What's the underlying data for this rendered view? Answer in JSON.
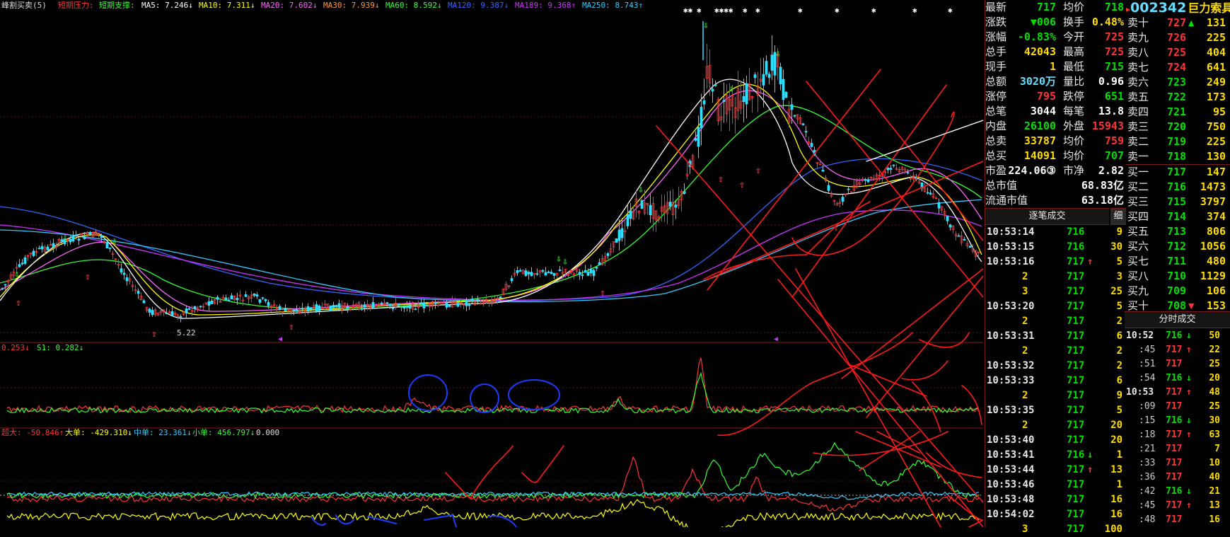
{
  "ma_bar": {
    "title": "峰割买卖(5)",
    "resist_label": "短期压力:",
    "support_label": "短期支撑:",
    "items": [
      {
        "label": "MA5: 7.246↓",
        "color": "#ffffff"
      },
      {
        "label": "MA10: 7.311↓",
        "color": "#ffff00"
      },
      {
        "label": "MA20: 7.602↓",
        "color": "#ff66ff"
      },
      {
        "label": "MA30: 7.939↓",
        "color": "#ff9933"
      },
      {
        "label": "MA60: 8.592↓",
        "color": "#33ff33"
      },
      {
        "label": "MA120: 9.387↓",
        "color": "#3366ff"
      },
      {
        "label": "MA189: 9.368↑",
        "color": "#cc33ff"
      },
      {
        "label": "MA250: 8.743↑",
        "color": "#33ccff"
      }
    ]
  },
  "price_annotation": "5.22",
  "indicator_bar": {
    "s0": "0.253↓",
    "s1": "S1: 0.282↓"
  },
  "flow_bar": {
    "items": [
      {
        "label": "超大: -50.846↑",
        "color": "#ff3333"
      },
      {
        "label": "大单: -429.310↓",
        "color": "#ffff00"
      },
      {
        "label": "中单: 23.361↓",
        "color": "#33ccff"
      },
      {
        "label": "小单: 456.797↓",
        "color": "#33ff33"
      },
      {
        "label": "0.000",
        "color": "#dddddd"
      }
    ]
  },
  "stock": {
    "code": "002342",
    "name": "巨力索具"
  },
  "quote": [
    {
      "l1": "最新",
      "v1": "717",
      "c1": "green",
      "l2": "均价",
      "v2": "718",
      "c2": "green"
    },
    {
      "l1": "涨跌",
      "v1": "▼006",
      "c1": "green",
      "l2": "换手",
      "v2": "0.48%",
      "c2": "yellow"
    },
    {
      "l1": "涨幅",
      "v1": "-0.83%",
      "c1": "green",
      "l2": "今开",
      "v2": "725",
      "c2": "red"
    },
    {
      "l1": "总手",
      "v1": "42043",
      "c1": "yellow",
      "l2": "最高",
      "v2": "725",
      "c2": "red"
    },
    {
      "l1": "现手",
      "v1": "1",
      "c1": "yellow",
      "l2": "最低",
      "v2": "715",
      "c2": "green"
    },
    {
      "l1": "总额",
      "v1": "3020万",
      "c1": "cyan",
      "l2": "量比",
      "v2": "0.96",
      "c2": "white"
    },
    {
      "l1": "涨停",
      "v1": "795",
      "c1": "red",
      "l2": "跌停",
      "v2": "651",
      "c2": "green"
    },
    {
      "l1": "总笔",
      "v1": "3044",
      "c1": "white",
      "l2": "每笔",
      "v2": "13.8",
      "c2": "white"
    },
    {
      "l1": "内盘",
      "v1": "26100",
      "c1": "green",
      "l2": "外盘",
      "v2": "15943",
      "c2": "red"
    },
    {
      "l1": "总卖",
      "v1": "33787",
      "c1": "yellow",
      "l2": "均价",
      "v2": "759",
      "c2": "red"
    },
    {
      "l1": "总买",
      "v1": "14091",
      "c1": "yellow",
      "l2": "均价",
      "v2": "707",
      "c2": "green"
    },
    {
      "l1": "市盈",
      "v1": "224.06③",
      "c1": "white",
      "l2": "市净",
      "v2": "2.82",
      "c2": "white"
    }
  ],
  "market_value": [
    {
      "label": "总市值",
      "value": "68.83亿"
    },
    {
      "label": "流通市值",
      "value": "63.18亿"
    }
  ],
  "trades_header": "逐笔成交",
  "trades_side_btn": "细",
  "trades": [
    {
      "t": "10:53:14",
      "p": "716",
      "q": "9",
      "a": ""
    },
    {
      "t": "10:53:15",
      "p": "716",
      "q": "30",
      "a": ""
    },
    {
      "t": "10:53:16",
      "p": "717",
      "q": "5",
      "a": "↑"
    },
    {
      "t": "2",
      "p": "717",
      "q": "3",
      "a": ""
    },
    {
      "t": "3",
      "p": "717",
      "q": "25",
      "a": ""
    },
    {
      "t": "10:53:20",
      "p": "717",
      "q": "5",
      "a": ""
    },
    {
      "t": "2",
      "p": "717",
      "q": "2",
      "a": ""
    },
    {
      "t": "10:53:31",
      "p": "717",
      "q": "6",
      "a": ""
    },
    {
      "t": "2",
      "p": "717",
      "q": "2",
      "a": ""
    },
    {
      "t": "10:53:32",
      "p": "717",
      "q": "2",
      "a": ""
    },
    {
      "t": "10:53:33",
      "p": "717",
      "q": "6",
      "a": ""
    },
    {
      "t": "2",
      "p": "717",
      "q": "9",
      "a": ""
    },
    {
      "t": "10:53:35",
      "p": "717",
      "q": "5",
      "a": ""
    },
    {
      "t": "2",
      "p": "717",
      "q": "20",
      "a": ""
    },
    {
      "t": "10:53:40",
      "p": "717",
      "q": "20",
      "a": ""
    },
    {
      "t": "10:53:41",
      "p": "716",
      "q": "1",
      "a": "↓"
    },
    {
      "t": "10:53:44",
      "p": "717",
      "q": "13",
      "a": "↑"
    },
    {
      "t": "10:53:46",
      "p": "717",
      "q": "1",
      "a": ""
    },
    {
      "t": "10:53:48",
      "p": "717",
      "q": "16",
      "a": ""
    },
    {
      "t": "10:54:02",
      "p": "717",
      "q": "16",
      "a": ""
    },
    {
      "t": "3",
      "p": "717",
      "q": "100",
      "a": ""
    }
  ],
  "order_book": {
    "asks": [
      {
        "label": "卖十",
        "p": "727",
        "q": "131",
        "c": "red",
        "a": "▲"
      },
      {
        "label": "卖九",
        "p": "726",
        "q": "225",
        "c": "red",
        "a": ""
      },
      {
        "label": "卖八",
        "p": "725",
        "q": "404",
        "c": "red",
        "a": ""
      },
      {
        "label": "卖七",
        "p": "724",
        "q": "641",
        "c": "red",
        "a": ""
      },
      {
        "label": "卖六",
        "p": "723",
        "q": "249",
        "c": "green",
        "a": ""
      },
      {
        "label": "卖五",
        "p": "722",
        "q": "173",
        "c": "green",
        "a": ""
      },
      {
        "label": "卖四",
        "p": "721",
        "q": "95",
        "c": "green",
        "a": ""
      },
      {
        "label": "卖三",
        "p": "720",
        "q": "750",
        "c": "green",
        "a": ""
      },
      {
        "label": "卖二",
        "p": "719",
        "q": "225",
        "c": "green",
        "a": ""
      },
      {
        "label": "卖一",
        "p": "718",
        "q": "130",
        "c": "green",
        "a": ""
      }
    ],
    "bids": [
      {
        "label": "买一",
        "p": "717",
        "q": "147",
        "c": "green",
        "a": ""
      },
      {
        "label": "买二",
        "p": "716",
        "q": "1473",
        "c": "green",
        "a": ""
      },
      {
        "label": "买三",
        "p": "715",
        "q": "3797",
        "c": "green",
        "a": ""
      },
      {
        "label": "买四",
        "p": "714",
        "q": "374",
        "c": "green",
        "a": ""
      },
      {
        "label": "买五",
        "p": "713",
        "q": "806",
        "c": "green",
        "a": ""
      },
      {
        "label": "买六",
        "p": "712",
        "q": "1056",
        "c": "green",
        "a": ""
      },
      {
        "label": "买七",
        "p": "711",
        "q": "480",
        "c": "green",
        "a": ""
      },
      {
        "label": "买八",
        "p": "710",
        "q": "1129",
        "c": "green",
        "a": ""
      },
      {
        "label": "买九",
        "p": "709",
        "q": "106",
        "c": "green",
        "a": ""
      },
      {
        "label": "买十",
        "p": "708",
        "q": "153",
        "c": "green",
        "a": "▼"
      }
    ]
  },
  "minute_header": "分时成交",
  "minute_trades": [
    {
      "t": "10:52",
      "p": "716",
      "a": "↓",
      "q": "50",
      "c": "green"
    },
    {
      "t": ":45",
      "p": "717",
      "a": "↑",
      "q": "22",
      "c": "red"
    },
    {
      "t": ":51",
      "p": "717",
      "a": "",
      "q": "25",
      "c": "red"
    },
    {
      "t": ":54",
      "p": "716",
      "a": "↓",
      "q": "20",
      "c": "green"
    },
    {
      "t": "10:53",
      "p": "717",
      "a": "↑",
      "q": "48",
      "c": "red"
    },
    {
      "t": ":09",
      "p": "717",
      "a": "",
      "q": "25",
      "c": "red"
    },
    {
      "t": ":15",
      "p": "716",
      "a": "↓",
      "q": "30",
      "c": "green"
    },
    {
      "t": ":18",
      "p": "717",
      "a": "↑",
      "q": "63",
      "c": "red"
    },
    {
      "t": ":21",
      "p": "717",
      "a": "",
      "q": "7",
      "c": "red"
    },
    {
      "t": ":33",
      "p": "717",
      "a": "",
      "q": "10",
      "c": "red"
    },
    {
      "t": ":36",
      "p": "717",
      "a": "",
      "q": "40",
      "c": "red"
    },
    {
      "t": ":42",
      "p": "716",
      "a": "↓",
      "q": "21",
      "c": "green"
    },
    {
      "t": ":45",
      "p": "717",
      "a": "↑",
      "q": "13",
      "c": "red"
    },
    {
      "t": ":48",
      "p": "717",
      "a": "",
      "q": "16",
      "c": "red"
    }
  ]
}
